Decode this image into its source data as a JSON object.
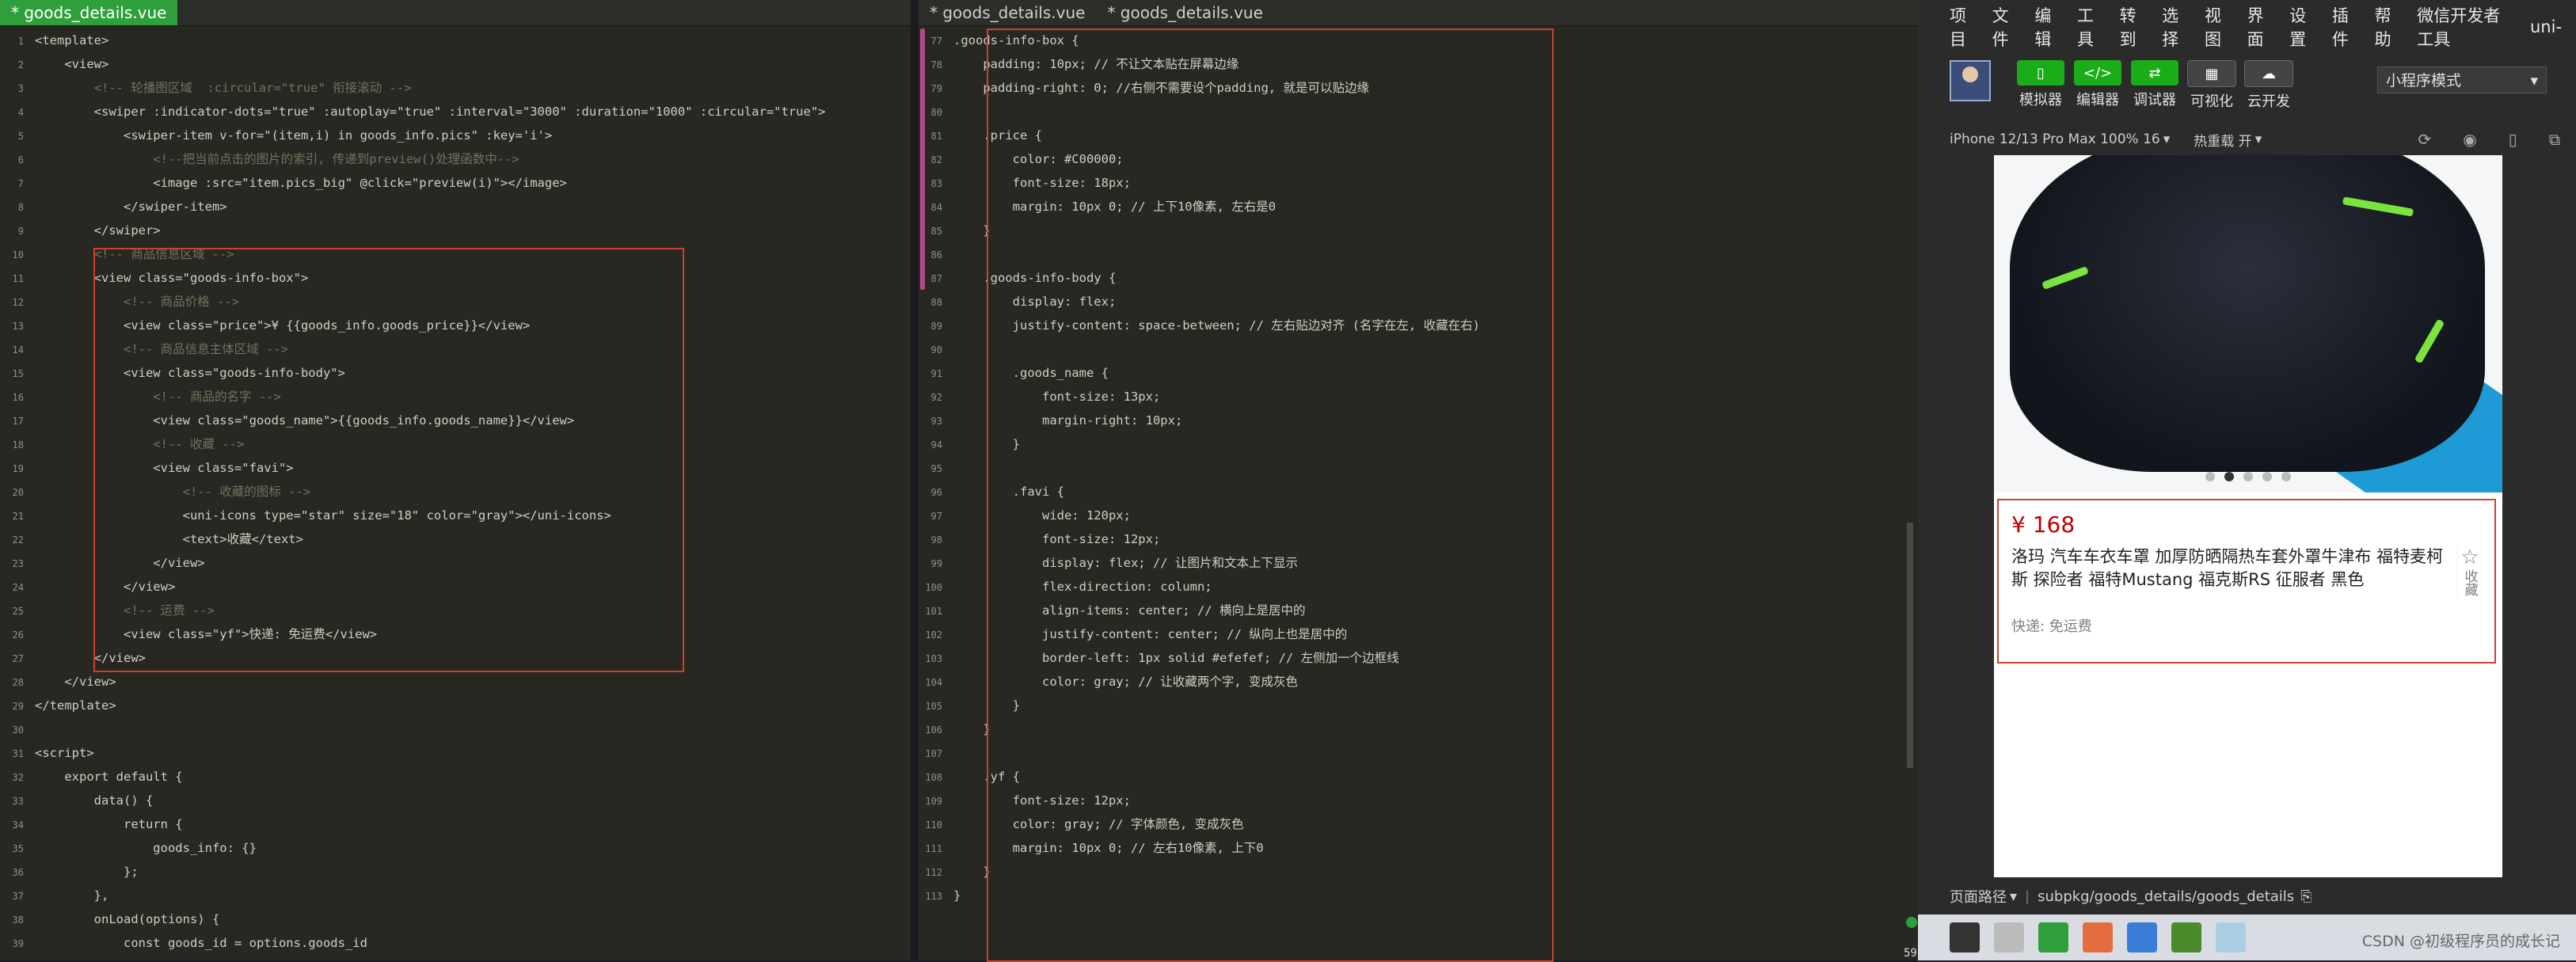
{
  "tabs": {
    "left": "* goods_details.vue",
    "mid1": "* goods_details.vue",
    "mid2": "* goods_details.vue"
  },
  "left_code": [
    {
      "n": "1",
      "t": "<template>"
    },
    {
      "n": "2",
      "t": "    <view>"
    },
    {
      "n": "3",
      "t": "        <!-- 轮播图区域  :circular=\"true\" 衔接滚动 -->"
    },
    {
      "n": "4",
      "t": "        <swiper :indicator-dots=\"true\" :autoplay=\"true\" :interval=\"3000\" :duration=\"1000\" :circular=\"true\">"
    },
    {
      "n": "5",
      "t": "            <swiper-item v-for=\"(item,i) in goods_info.pics\" :key='i'>"
    },
    {
      "n": "6",
      "t": "                <!--把当前点击的图片的索引, 传递到preview()处理函数中-->"
    },
    {
      "n": "7",
      "t": "                <image :src=\"item.pics_big\" @click=\"preview(i)\"></image>"
    },
    {
      "n": "8",
      "t": "            </swiper-item>"
    },
    {
      "n": "9",
      "t": "        </swiper>"
    },
    {
      "n": "10",
      "t": "        <!-- 商品信息区域 -->"
    },
    {
      "n": "11",
      "t": "        <view class=\"goods-info-box\">"
    },
    {
      "n": "12",
      "t": "            <!-- 商品价格 -->"
    },
    {
      "n": "13",
      "t": "            <view class=\"price\">¥ {{goods_info.goods_price}}</view>"
    },
    {
      "n": "14",
      "t": "            <!-- 商品信息主体区域 -->"
    },
    {
      "n": "15",
      "t": "            <view class=\"goods-info-body\">"
    },
    {
      "n": "16",
      "t": "                <!-- 商品的名字 -->"
    },
    {
      "n": "17",
      "t": "                <view class=\"goods_name\">{{goods_info.goods_name}}</view>"
    },
    {
      "n": "18",
      "t": "                <!-- 收藏 -->"
    },
    {
      "n": "19",
      "t": "                <view class=\"favi\">"
    },
    {
      "n": "20",
      "t": "                    <!-- 收藏的图标 -->"
    },
    {
      "n": "21",
      "t": "                    <uni-icons type=\"star\" size=\"18\" color=\"gray\"></uni-icons>"
    },
    {
      "n": "22",
      "t": "                    <text>收藏</text>"
    },
    {
      "n": "23",
      "t": "                </view>"
    },
    {
      "n": "24",
      "t": "            </view>"
    },
    {
      "n": "25",
      "t": "            <!-- 运费 -->"
    },
    {
      "n": "26",
      "t": "            <view class=\"yf\">快递: 免运费</view>"
    },
    {
      "n": "27",
      "t": "        </view>"
    },
    {
      "n": "28",
      "t": "    </view>"
    },
    {
      "n": "29",
      "t": "</template>"
    },
    {
      "n": "30",
      "t": ""
    },
    {
      "n": "31",
      "t": "<script>"
    },
    {
      "n": "32",
      "t": "    export default {"
    },
    {
      "n": "33",
      "t": "        data() {"
    },
    {
      "n": "34",
      "t": "            return {"
    },
    {
      "n": "35",
      "t": "                goods_info: {}"
    },
    {
      "n": "36",
      "t": "            };"
    },
    {
      "n": "37",
      "t": "        },"
    },
    {
      "n": "38",
      "t": "        onLoad(options) {"
    },
    {
      "n": "39",
      "t": "            const goods_id = options.goods_id"
    }
  ],
  "mid_code": [
    {
      "n": "77",
      "t": ".goods-info-box {"
    },
    {
      "n": "78",
      "t": "    padding: 10px; // 不让文本贴在屏幕边缘"
    },
    {
      "n": "79",
      "t": "    padding-right: 0; //右侧不需要设个padding, 就是可以贴边缘"
    },
    {
      "n": "80",
      "t": ""
    },
    {
      "n": "81",
      "t": "    .price {"
    },
    {
      "n": "82",
      "t": "        color: #C00000;"
    },
    {
      "n": "83",
      "t": "        font-size: 18px;"
    },
    {
      "n": "84",
      "t": "        margin: 10px 0; // 上下10像素, 左右是0"
    },
    {
      "n": "85",
      "t": "    }"
    },
    {
      "n": "86",
      "t": ""
    },
    {
      "n": "87",
      "t": "    .goods-info-body {"
    },
    {
      "n": "88",
      "t": "        display: flex;"
    },
    {
      "n": "89",
      "t": "        justify-content: space-between; // 左右贴边对齐 (名字在左, 收藏在右)"
    },
    {
      "n": "90",
      "t": ""
    },
    {
      "n": "91",
      "t": "        .goods_name {"
    },
    {
      "n": "92",
      "t": "            font-size: 13px;"
    },
    {
      "n": "93",
      "t": "            margin-right: 10px;"
    },
    {
      "n": "94",
      "t": "        }"
    },
    {
      "n": "95",
      "t": ""
    },
    {
      "n": "96",
      "t": "        .favi {"
    },
    {
      "n": "97",
      "t": "            wide: 120px;"
    },
    {
      "n": "98",
      "t": "            font-size: 12px;"
    },
    {
      "n": "99",
      "t": "            display: flex; // 让图片和文本上下显示"
    },
    {
      "n": "100",
      "t": "            flex-direction: column;"
    },
    {
      "n": "101",
      "t": "            align-items: center; // 横向上是居中的"
    },
    {
      "n": "102",
      "t": "            justify-content: center; // 纵向上也是居中的"
    },
    {
      "n": "103",
      "t": "            border-left: 1px solid #efefef; // 左侧加一个边框线"
    },
    {
      "n": "104",
      "t": "            color: gray; // 让收藏两个字, 变成灰色"
    },
    {
      "n": "105",
      "t": "        }"
    },
    {
      "n": "106",
      "t": "    }"
    },
    {
      "n": "107",
      "t": ""
    },
    {
      "n": "108",
      "t": "    .yf {"
    },
    {
      "n": "109",
      "t": "        font-size: 12px;"
    },
    {
      "n": "110",
      "t": "        color: gray; // 字体颜色, 变成灰色"
    },
    {
      "n": "111",
      "t": "        margin: 10px 0; // 左右10像素, 上下0"
    },
    {
      "n": "112",
      "t": "    }"
    },
    {
      "n": "113",
      "t": "}"
    }
  ],
  "menu": [
    "项目",
    "文件",
    "编辑",
    "工具",
    "转到",
    "选择",
    "视图",
    "界面",
    "设置",
    "插件",
    "帮助",
    "微信开发者工具",
    "uni-"
  ],
  "tools": [
    {
      "label": "模拟器",
      "icon": "phone-icon"
    },
    {
      "label": "编辑器",
      "icon": "code-icon"
    },
    {
      "label": "调试器",
      "icon": "debug-icon"
    },
    {
      "label": "可视化",
      "icon": "layout-icon"
    },
    {
      "label": "云开发",
      "icon": "cloud-icon"
    }
  ],
  "mode_select": "小程序模式",
  "device": "iPhone 12/13 Pro Max 100% 16",
  "hot_reload": "热重载 开",
  "preview": {
    "price": "¥ 168",
    "goods_name": "洛玛 汽车车衣车罩 加厚防晒隔热车套外罩牛津布 福特麦柯斯 探险者 福特Mustang 福克斯RS 征服者 黑色",
    "favi_text": "收藏",
    "yf": "快递: 免运费",
    "dots": 5,
    "active_dot": 1
  },
  "pathbar": {
    "label": "页面路径",
    "path": "subpkg/goods_details/goods_details"
  },
  "watermark": "CSDN @初级程序员的成长记",
  "colnum": "59",
  "colors": {
    "accent_green": "#2e9f3a",
    "highlight_red": "#d0402f",
    "price_red": "#c00000"
  }
}
